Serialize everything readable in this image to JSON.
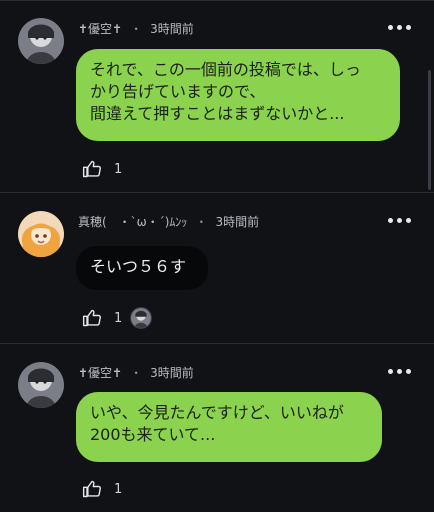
{
  "colors": {
    "background": "#111216",
    "green_bubble": "#8bd34e",
    "dark_bubble": "#07080a",
    "divider": "#2a2c33"
  },
  "comments": [
    {
      "author": "✝優空✝",
      "time": "3時間前",
      "avatar_icon": "gray-character-avatar",
      "bubble_lines": [
        "それで、この一個前の投稿では、しっ",
        "かり告げていますので、",
        "間違えて押すことはまずないかと..."
      ],
      "likes": "1"
    },
    {
      "author": "真穂(　・`ω・´)ﾑﾝｯ",
      "time": "3時間前",
      "avatar_icon": "orange-hair-character-avatar",
      "bubble_lines": [
        "そいつ５６す"
      ],
      "likes": "1"
    },
    {
      "author": "✝優空✝",
      "time": "3時間前",
      "avatar_icon": "gray-character-avatar",
      "bubble_lines": [
        "いや、今見たんですけど、いいねが",
        "200も来ていて..."
      ],
      "likes": "1"
    }
  ],
  "separator": "・"
}
